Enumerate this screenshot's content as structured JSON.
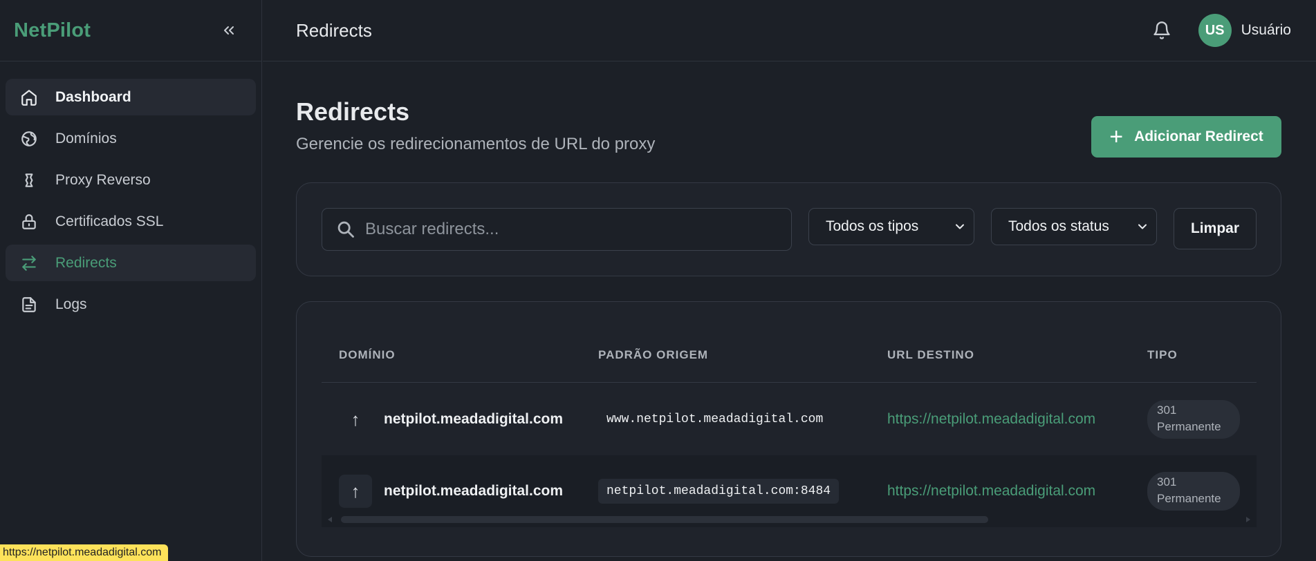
{
  "sidebar": {
    "brand": "NetPilot",
    "items": [
      {
        "label": "Dashboard",
        "icon": "home-icon"
      },
      {
        "label": "Domínios",
        "icon": "globe-icon"
      },
      {
        "label": "Proxy Reverso",
        "icon": "proxy-icon"
      },
      {
        "label": "Certificados SSL",
        "icon": "lock-icon"
      },
      {
        "label": "Redirects",
        "icon": "swap-arrows-icon",
        "active": true
      },
      {
        "label": "Logs",
        "icon": "file-text-icon"
      }
    ]
  },
  "topbar": {
    "title": "Redirects",
    "avatar_initials": "US",
    "user_name": "Usuário"
  },
  "page": {
    "title": "Redirects",
    "subtitle": "Gerencie os redirecionamentos de URL do proxy",
    "add_button": "Adicionar Redirect"
  },
  "filters": {
    "search_placeholder": "Buscar redirects...",
    "type_select": "Todos os tipos",
    "status_select": "Todos os status",
    "clear_button": "Limpar"
  },
  "table": {
    "headers": [
      "DOMÍNIO",
      "PADRÃO ORIGEM",
      "URL DESTINO",
      "TIPO"
    ],
    "rows": [
      {
        "domain": "netpilot.meadadigital.com",
        "pattern": "www.netpilot.meadadigital.com",
        "destination": "https://netpilot.meadadigital.com",
        "type_code": "301",
        "type_label": "Permanente"
      },
      {
        "domain": "netpilot.meadadigital.com",
        "pattern": "netpilot.meadadigital.com:8484",
        "destination": "https://netpilot.meadadigital.com",
        "type_code": "301",
        "type_label": "Permanente"
      }
    ]
  },
  "status_bar": {
    "link_preview": "https://netpilot.meadadigital.com"
  },
  "colors": {
    "accent": "#4a9d78",
    "background": "#1c2027",
    "card": "#1f232b"
  }
}
